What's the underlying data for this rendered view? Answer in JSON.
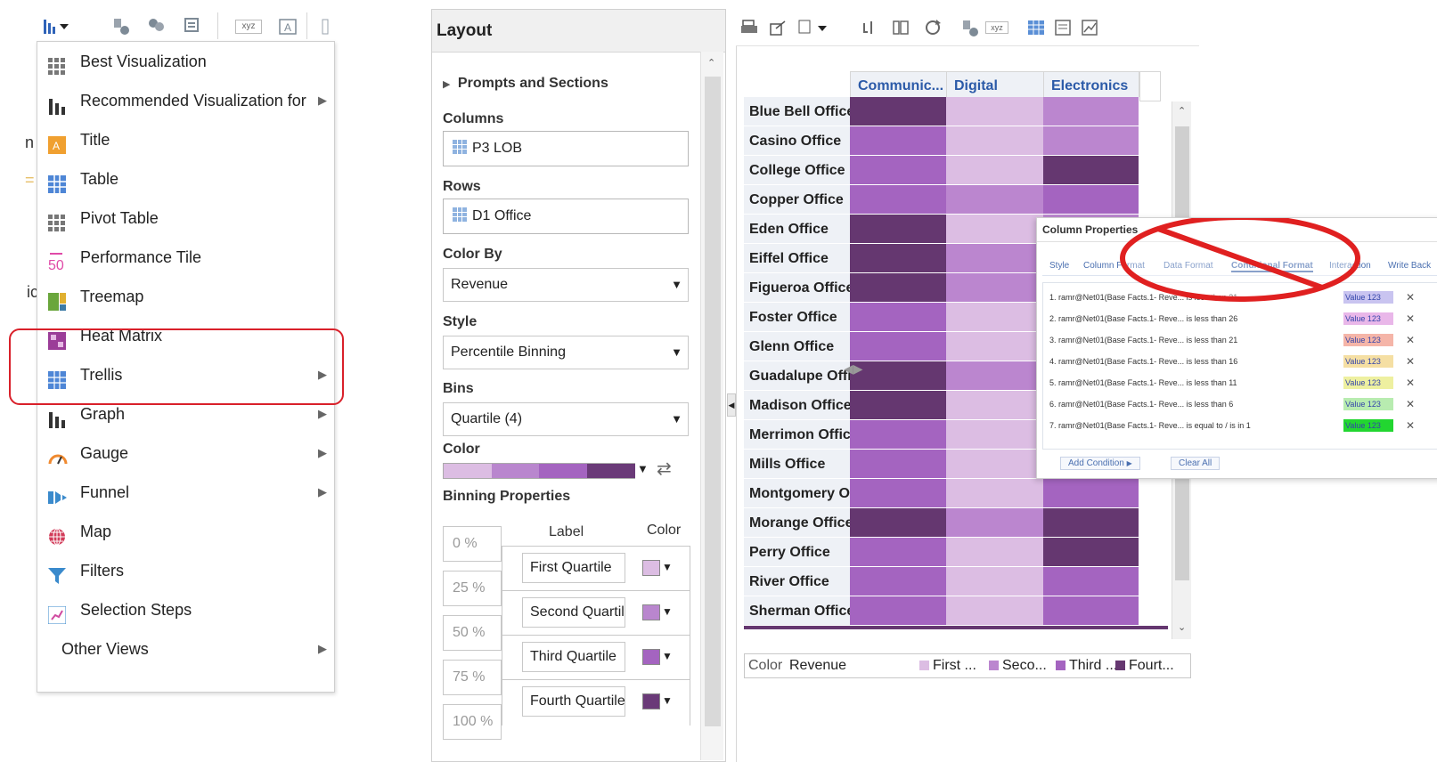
{
  "toolbar_left": {
    "icons": [
      "bar-chart-dropdown-icon",
      "new-view-icon",
      "people-icon",
      "report-icon",
      "xyz-icon",
      "text-format-icon"
    ],
    "xyz_label": "xyz"
  },
  "menu": {
    "items": [
      {
        "label": "Best Visualization",
        "icon": "grid-icon",
        "submenu": false
      },
      {
        "label": "Recommended Visualization for",
        "icon": "bar-chart-icon",
        "submenu": true
      },
      {
        "label": "Title",
        "icon": "title-icon",
        "submenu": false
      },
      {
        "label": "Table",
        "icon": "table-icon",
        "submenu": false
      },
      {
        "label": "Pivot Table",
        "icon": "pivot-table-icon",
        "submenu": false
      },
      {
        "label": "Performance Tile",
        "icon": "performance-tile-icon",
        "icon_text": "50",
        "submenu": false
      },
      {
        "label": "Treemap",
        "icon": "treemap-icon",
        "submenu": false
      },
      {
        "label": "Heat Matrix",
        "icon": "heat-matrix-icon",
        "submenu": false
      },
      {
        "label": "Trellis",
        "icon": "trellis-icon",
        "submenu": true
      },
      {
        "label": "Graph",
        "icon": "graph-icon",
        "submenu": true
      },
      {
        "label": "Gauge",
        "icon": "gauge-icon",
        "submenu": true
      },
      {
        "label": "Funnel",
        "icon": "funnel-icon",
        "submenu": true
      },
      {
        "label": "Map",
        "icon": "globe-icon",
        "submenu": false
      },
      {
        "label": "Filters",
        "icon": "filter-icon",
        "submenu": false
      },
      {
        "label": "Selection Steps",
        "icon": "selection-steps-icon",
        "submenu": false
      },
      {
        "label": "Other Views",
        "icon": "",
        "submenu": true
      }
    ],
    "highlighted": [
      "Heat Matrix",
      "Trellis"
    ]
  },
  "layout": {
    "title": "Layout",
    "prompts_sections": "Prompts and Sections",
    "columns_label": "Columns",
    "columns_value": "P3 LOB",
    "rows_label": "Rows",
    "rows_value": "D1 Office",
    "color_by_label": "Color By",
    "color_by_value": "Revenue",
    "style_label": "Style",
    "style_value": "Percentile Binning",
    "bins_label": "Bins",
    "bins_value": "Quartile (4)",
    "color_label": "Color",
    "palette": [
      "#dcbde3",
      "#b986ce",
      "#a464c0",
      "#6a3a78"
    ],
    "binning_label": "Binning Properties",
    "label_header": "Label",
    "color_header": "Color",
    "percents": [
      "0 %",
      "25 %",
      "50 %",
      "75 %",
      "100 %"
    ],
    "bin_labels": [
      "First Quartile",
      "Second Quartil",
      "Third Quartile",
      "Fourth Quartile"
    ]
  },
  "matrix": {
    "columns": [
      "Communic...",
      "Digital",
      "Electronics"
    ],
    "rows": [
      "Blue Bell Office",
      "Casino Office",
      "College Office",
      "Copper Office",
      "Eden Office",
      "Eiffel Office",
      "Figueroa Office",
      "Foster Office",
      "Glenn Office",
      "Guadalupe Office",
      "Madison Office",
      "Merrimon Office",
      "Mills Office",
      "Montgomery Office",
      "Morange Office",
      "Perry Office",
      "River Office",
      "Sherman Office"
    ],
    "bins": [
      [
        4,
        1,
        2
      ],
      [
        3,
        1,
        2
      ],
      [
        3,
        1,
        4
      ],
      [
        3,
        2,
        3
      ],
      [
        4,
        1,
        2
      ],
      [
        4,
        2,
        2
      ],
      [
        4,
        2,
        2
      ],
      [
        3,
        1,
        2
      ],
      [
        3,
        1,
        2
      ],
      [
        4,
        2,
        2
      ],
      [
        4,
        1,
        2
      ],
      [
        3,
        1,
        2
      ],
      [
        3,
        1,
        2
      ],
      [
        3,
        1,
        3
      ],
      [
        4,
        2,
        4
      ],
      [
        3,
        1,
        4
      ],
      [
        3,
        1,
        3
      ],
      [
        3,
        1,
        3
      ]
    ],
    "bin_colors": {
      "1": "#dcbde3",
      "2": "#bb86cf",
      "3": "#a464c0",
      "4": "#653770"
    },
    "legend": {
      "title": "Color",
      "measure": "Revenue",
      "entries": [
        {
          "label": "First ...",
          "color": "#dcbde3"
        },
        {
          "label": "Seco...",
          "color": "#bb86cf"
        },
        {
          "label": "Third ...",
          "color": "#a464c0"
        },
        {
          "label": "Fourt...",
          "color": "#653770"
        }
      ]
    }
  },
  "column_properties": {
    "title": "Column Properties",
    "tabs": [
      "Style",
      "Column Format",
      "Data Format",
      "Conditional Format",
      "Interaction",
      "Write Back"
    ],
    "conditions": [
      {
        "text": "1. ramr@Net01(Base Facts.1- Reve... is less than 31",
        "chip": "Value 123",
        "chip_color": "#c9c4f0"
      },
      {
        "text": "2. ramr@Net01(Base Facts.1- Reve... is less than 26",
        "chip": "Value 123",
        "chip_color": "#e9b7e9"
      },
      {
        "text": "3. ramr@Net01(Base Facts.1- Reve... is less than 21",
        "chip": "Value 123",
        "chip_color": "#f5b5a8"
      },
      {
        "text": "4. ramr@Net01(Base Facts.1- Reve... is less than 16",
        "chip": "Value 123",
        "chip_color": "#f5dfa3"
      },
      {
        "text": "5. ramr@Net01(Base Facts.1- Reve... is less than 11",
        "chip": "Value 123",
        "chip_color": "#eef0a0"
      },
      {
        "text": "6. ramr@Net01(Base Facts.1- Reve... is less than 6",
        "chip": "Value 123",
        "chip_color": "#b8ecb0"
      },
      {
        "text": "7. ramr@Net01(Base Facts.1- Reve... is equal to / is in 1",
        "chip": "Value 123",
        "chip_color": "#22d630"
      }
    ],
    "add_condition": "Add Condition",
    "clear_all": "Clear All"
  },
  "toolbar_right": {
    "icons": [
      "print-icon",
      "export-icon",
      "data-dropdown-icon",
      "refresh-icon",
      "columns-icon",
      "reload-icon",
      "new-view-icon",
      "xyz-icon",
      "table-icon",
      "pivot-icon",
      "chart-icon"
    ],
    "xyz_label": "xyz"
  }
}
